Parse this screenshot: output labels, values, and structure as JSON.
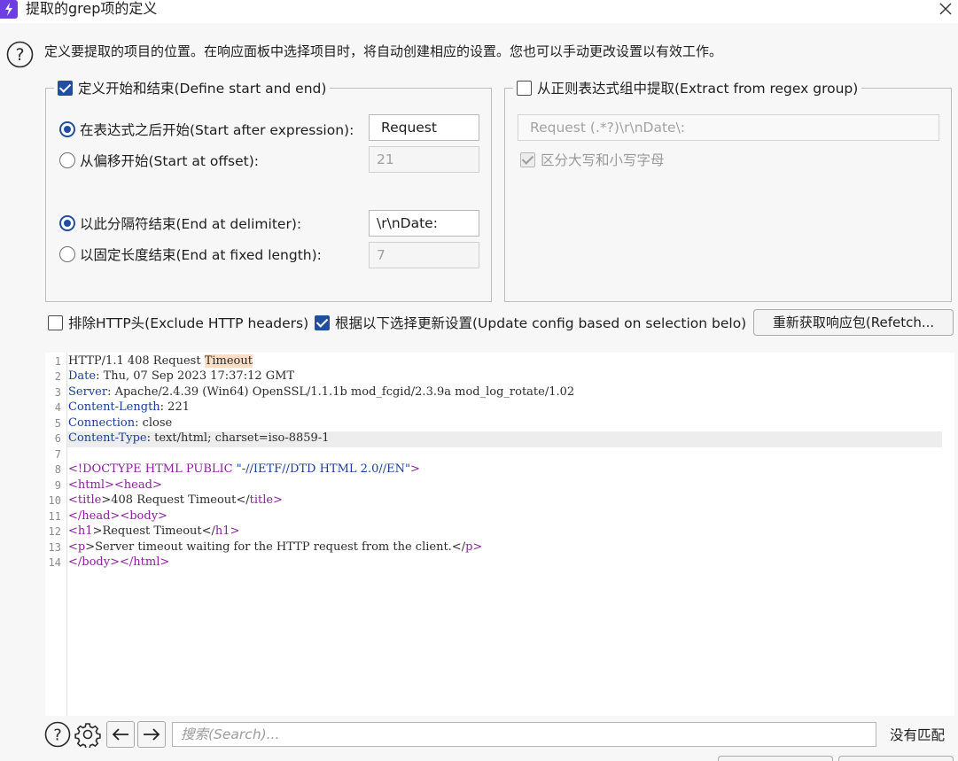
{
  "window": {
    "title": "提取的grep项的定义",
    "app_icon": "lightning-icon",
    "close_icon": "close-icon"
  },
  "intro": {
    "help_icon": "help-icon",
    "text": "定义要提取的项目的位置。在响应面板中选择项目时，将自动创建相应的设置。您也可以手动更改设置以有效工作。"
  },
  "define_group": {
    "legend": "定义开始和结束(Define start and end)",
    "checked": true,
    "start_after_expression": {
      "label": "在表达式之后开始(Start after expression):",
      "value": "Request",
      "selected": true
    },
    "start_at_offset": {
      "label": "从偏移开始(Start at offset):",
      "value": "21",
      "selected": false
    },
    "end_at_delimiter": {
      "label": "以此分隔符结束(End at delimiter):",
      "value": "\\r\\nDate:",
      "selected": true
    },
    "end_at_fixed_length": {
      "label": "以固定长度结束(End at fixed length):",
      "value": "7",
      "selected": false
    }
  },
  "regex_group": {
    "legend": "从正则表达式组中提取(Extract from regex group)",
    "checked": false,
    "regex_value": "Request (.*?)\\r\\nDate\\:",
    "case_sensitive_label": "区分大写和小写字母",
    "case_sensitive_checked": true
  },
  "options": {
    "exclude_headers_label": "排除HTTP头(Exclude HTTP headers)",
    "exclude_headers_checked": false,
    "update_config_label": "根据以下选择更新设置(Update config based on selection belo)",
    "update_config_checked": true,
    "refetch_button": "重新获取响应包(Refetch..."
  },
  "editor": {
    "line_numbers": [
      "1",
      "2",
      "3",
      "4",
      "5",
      "6",
      "7",
      "8",
      "9",
      "10",
      "11",
      "12",
      "13",
      "14"
    ],
    "l1_text": "HTTP/1.1 408 Request ",
    "l1_highlight": "Timeout",
    "l2_key": "Date",
    "l2_val": ": Thu, 07 Sep 2023 17:37:12 GMT",
    "l3_key": "Server",
    "l3_val": ": Apache/2.4.39 (Win64) OpenSSL/1.1.1b mod_fcgid/2.3.9a mod_log_rotate/1.02",
    "l4_key": "Content-Length",
    "l4_val": ": 221",
    "l5_key": "Connection",
    "l5_val": ": close",
    "l6_key": "Content-Type",
    "l6_val": ": text/html; charset=iso-8859-1",
    "l8_a": "<!DOCTYPE HTML PUBLIC ",
    "l8_b": "\"-//IETF//DTD HTML 2.0//EN\"",
    "l8_c": ">",
    "l9_a": "<",
    "l9_b": "html",
    "l9_c": "><",
    "l9_d": "head",
    "l9_e": ">",
    "l10_a": "<",
    "l10_b": "title",
    "l10_c": ">408 Request Timeout</",
    "l10_d": "title",
    "l10_e": ">",
    "l11_a": "</",
    "l11_b": "head",
    "l11_c": "><",
    "l11_d": "body",
    "l11_e": ">",
    "l12_a": "<",
    "l12_b": "h1",
    "l12_c": ">Request Timeout</",
    "l12_d": "h1",
    "l12_e": ">",
    "l13_a": "<",
    "l13_b": "p",
    "l13_c": ">Server timeout waiting for the HTTP request from the client.</",
    "l13_d": "p",
    "l13_e": ">",
    "l14_a": "</",
    "l14_b": "body",
    "l14_c": "></",
    "l14_d": "html",
    "l14_e": ">"
  },
  "search": {
    "help_icon": "help-icon",
    "settings_icon": "gear-icon",
    "prev_icon": "arrow-left-icon",
    "next_icon": "arrow-right-icon",
    "placeholder": "搜索(Search)...",
    "status": "没有匹配"
  },
  "colors": {
    "accent": "#1f4f9e",
    "highlight": "#fbdcc5",
    "keyword": "#1a3d96",
    "tag": "#8b1f9c"
  }
}
